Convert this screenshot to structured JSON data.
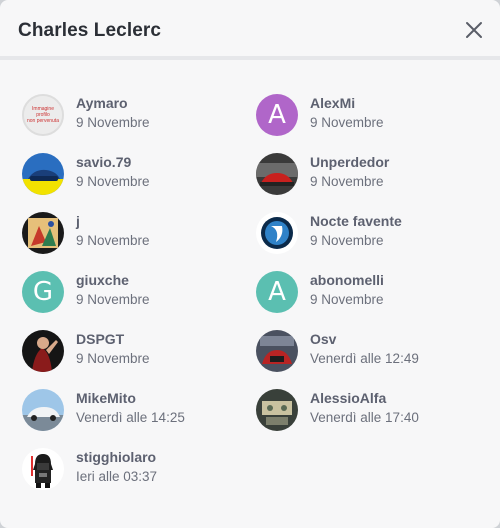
{
  "dialog": {
    "title": "Charles Leclerc",
    "close_icon": "close-icon"
  },
  "colors": {
    "purple_avatar": "#b066c9",
    "teal_avatar": "#5bbfb1"
  },
  "users": [
    {
      "name": "Aymaro",
      "date": "9 Novembre",
      "avatar_text": "Immagine profilo non pervenuta"
    },
    {
      "name": "AlexMi",
      "date": "9 Novembre",
      "letter": "A"
    },
    {
      "name": "savio.79",
      "date": "9 Novembre"
    },
    {
      "name": "Unperdedor",
      "date": "9 Novembre"
    },
    {
      "name": "j",
      "date": "9 Novembre"
    },
    {
      "name": "Nocte favente",
      "date": "9 Novembre"
    },
    {
      "name": "giuxche",
      "date": "9 Novembre",
      "letter": "G"
    },
    {
      "name": "abonomelli",
      "date": "9 Novembre",
      "letter": "A"
    },
    {
      "name": "DSPGT",
      "date": "9 Novembre"
    },
    {
      "name": "Osv",
      "date": "Venerdì alle 12:49"
    },
    {
      "name": "MikeMito",
      "date": "Venerdì alle 14:25"
    },
    {
      "name": "AlessioAlfa",
      "date": "Venerdì alle 17:40"
    },
    {
      "name": "stigghiolaro",
      "date": "Ieri alle 03:37"
    }
  ]
}
